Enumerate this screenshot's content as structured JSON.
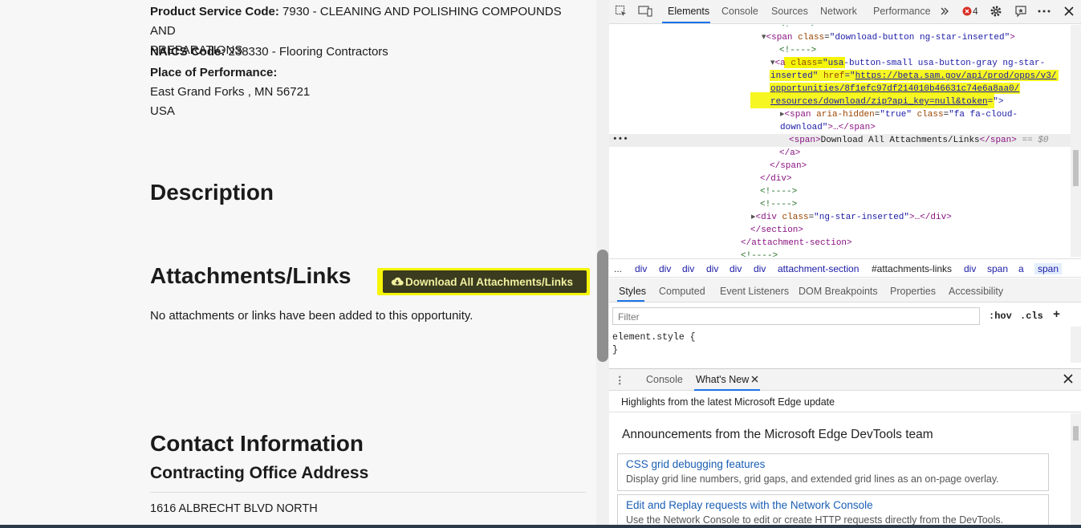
{
  "page": {
    "psc_label": "Product Service Code:",
    "psc_value": " 7930 - CLEANING AND POLISHING COMPOUNDS AND",
    "psc_value_cont": "PREPARATIONS",
    "naics_label": "NAICS Code:",
    "naics_value": " 238330 - Flooring Contractors",
    "pop_label": "Place of Performance:",
    "pop_city": "East Grand Forks , MN 56721",
    "pop_country": "USA",
    "description_heading": "Description",
    "attachments_heading": "Attachments/Links",
    "download_button": "Download All Attachments/Links",
    "no_attachments": "No attachments or links have been added to this opportunity.",
    "contact_heading": "Contact Information",
    "office_heading": "Contracting Office Address",
    "address_line1": "1616 ALBRECHT BLVD NORTH"
  },
  "devtools": {
    "tabs": [
      "Elements",
      "Console",
      "Sources",
      "Network",
      "Performance"
    ],
    "more_tabs_icon": "chevron-double-right",
    "error_count": "4",
    "accent": "#1a73e8",
    "highlight_color": "#f5f50a",
    "code_lines": {
      "l0": "<!---->",
      "l1_tag": "<span ",
      "l1_attr": "class",
      "l1_val": "\"download-button ng-star-inserted\"",
      "l1_end": ">",
      "l2": "<!---->",
      "l3_tag": "<a ",
      "l3_attr": "class",
      "l3_val": "\"usa-button-small usa-button-gray ng-star-",
      "l4_val": "inserted\"",
      "l4_attr": " href",
      "l4_eq": "=\"",
      "l4_url": "https://beta.sam.gov/api/prod/opps/v3/",
      "l5_url": "opportunities/8f1efc97df214010b46631c74e6a8aa0/",
      "l6_url": "resources/download/zip?api_key=null&token",
      "l6_end": "=\">",
      "l7_tag": "<span ",
      "l7_attr": "aria-hidden",
      "l7_val": "\"true\"",
      "l7_attr2": " class",
      "l7_val2": "\"fa fa-cloud-",
      "l8_val": "download\"",
      "l8_end": ">…</span>",
      "l9_open": "<span>",
      "l9_text": "Download All Attachments/Links",
      "l9_close": "</span>",
      "l9_eq": " == $0",
      "l10": "</a>",
      "l11": "</span>",
      "l12": "</div>",
      "l13": "<!---->",
      "l14": "<!---->",
      "l15_tag": "<div ",
      "l15_attr": "class",
      "l15_val": "\"ng-star-inserted\"",
      "l15_end": ">…</div>",
      "l16": "</section>",
      "l17": "</attachment-section>",
      "l18": "<!---->"
    },
    "breadcrumbs": [
      "...",
      "div",
      "div",
      "div",
      "div",
      "div",
      "div",
      "attachment-section",
      "#attachments-links",
      "div",
      "span",
      "a",
      "span"
    ],
    "styles_tabs": [
      "Styles",
      "Computed",
      "Event Listeners",
      "DOM Breakpoints",
      "Properties",
      "Accessibility"
    ],
    "filter_placeholder": "Filter",
    "hov": ":hov",
    "cls": ".cls",
    "plus": "+",
    "element_style": "element.style {\n}",
    "drawer_tabs": [
      "Console",
      "What's New"
    ],
    "whats_new_header": "Highlights from the latest Microsoft Edge update",
    "announcements_title": "Announcements from the Microsoft Edge DevTools team",
    "cards": [
      {
        "title": "CSS grid debugging features",
        "desc": "Display grid line numbers, grid gaps, and extended grid lines as an on-page overlay."
      },
      {
        "title": "Edit and Replay requests with the Network Console",
        "desc": "Use the Network Console to edit or create HTTP requests directly from the DevTools."
      }
    ]
  }
}
